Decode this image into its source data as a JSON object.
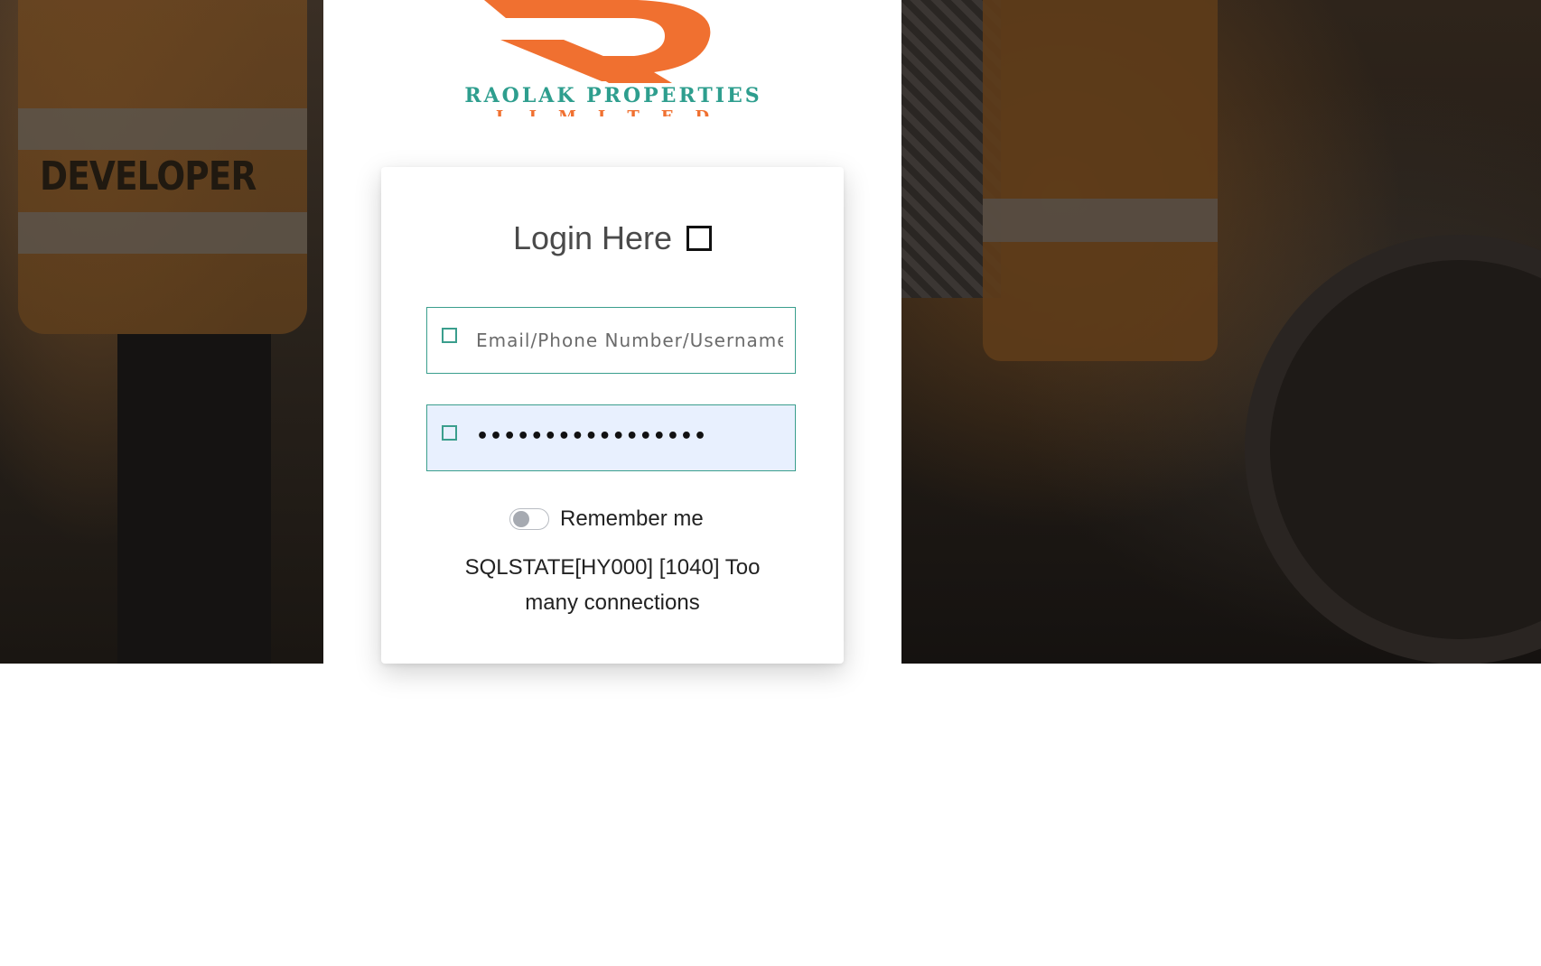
{
  "logo": {
    "brand_name": "RAOLAK PROPERTIES",
    "brand_sub": "LIMITED",
    "colors": {
      "orange": "#F07030",
      "teal": "#2E9E8E"
    }
  },
  "background": {
    "vest_text": "DEVELOPER"
  },
  "login": {
    "title": "Login Here",
    "title_icon": "square-icon",
    "email_placeholder": "Email/Phone Number/Username",
    "email_value": "",
    "email_icon": "user-icon",
    "password_value": "•••••••••••••••••",
    "password_icon": "lock-icon",
    "remember_label": "Remember me",
    "remember_checked": false,
    "error_message": "SQLSTATE[HY000] [1040] Too many connections"
  },
  "colors": {
    "accent": "#3A9E8D",
    "autofill_bg": "#E8F0FE",
    "text": "#222222"
  }
}
